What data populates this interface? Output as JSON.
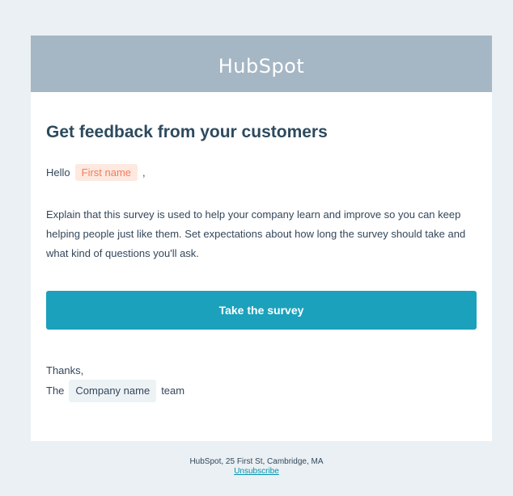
{
  "header": {
    "logo_text": "HubSpot"
  },
  "email": {
    "headline": "Get feedback from your customers",
    "greeting": {
      "hello": "Hello",
      "first_name_token": "First name",
      "comma": ","
    },
    "body": "Explain that this survey is used to help your company learn and improve so you can keep helping people just like them. Set expectations about how long the survey should take and what kind of questions you'll ask.",
    "cta_label": "Take the survey",
    "signoff": {
      "thanks": "Thanks,",
      "the": "The",
      "company_token": "Company name",
      "team": "team"
    }
  },
  "footer": {
    "address": "HubSpot, 25 First St, Cambridge, MA",
    "unsubscribe": "Unsubscribe"
  },
  "colors": {
    "header_bg": "#a5b6c4",
    "cta_bg": "#1ba1bc",
    "page_bg": "#eaf0f3",
    "token_orange": "#f27d5e"
  }
}
